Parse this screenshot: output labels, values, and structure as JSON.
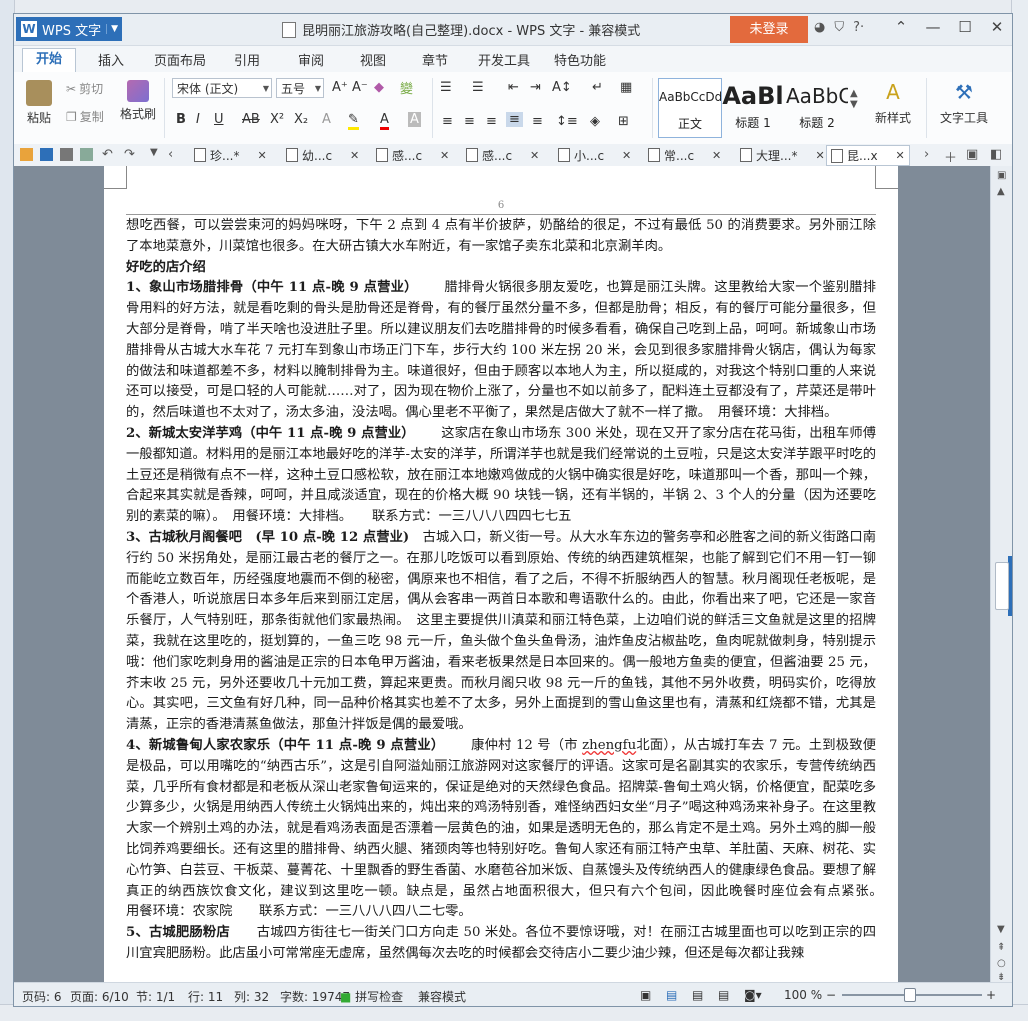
{
  "app": {
    "name": "WPS 文字",
    "window_title": "昆明丽江旅游攻略(自己整理).docx - WPS 文字 - 兼容模式",
    "login_label": "未登录"
  },
  "ribbon_tabs": [
    "开始",
    "插入",
    "页面布局",
    "引用",
    "审阅",
    "视图",
    "章节",
    "开发工具",
    "特色功能"
  ],
  "ribbon": {
    "paste": "粘贴",
    "cut": "剪切",
    "copy": "复制",
    "format_painter": "格式刷",
    "font_name": "宋体 (正文)",
    "font_size": "五号",
    "styles": [
      {
        "sample": "AaBbCcDd",
        "name": "正文"
      },
      {
        "sample": "AaBl",
        "name": "标题 1"
      },
      {
        "sample": "AaBbC",
        "name": "标题 2"
      }
    ],
    "new_style": "新样式",
    "text_tools": "文字工具"
  },
  "doc_tabs": [
    {
      "label": "珍...*"
    },
    {
      "label": "幼...c"
    },
    {
      "label": "感...c"
    },
    {
      "label": "感...c"
    },
    {
      "label": "小...c"
    },
    {
      "label": "常...c"
    },
    {
      "label": "大理...*"
    },
    {
      "label": "昆...x"
    }
  ],
  "page": {
    "number": "6"
  },
  "content": {
    "p1": "想吃西餐，可以尝尝束河的妈妈咪呀，下午 2 点到 4 点有半价披萨，奶酪给的很足，不过有最低 50 的消费要求。另外丽江除了本地菜意外，川菜馆也很多。在大研古镇大水车附近，有一家馆子卖东北菜和北京涮羊肉。",
    "h_shops": "好吃的店介绍",
    "s1_title": "1、象山市场腊排骨（中午 11 点-晚 9 点营业）",
    "s1_body": "腊排骨火锅很多朋友爱吃，也算是丽江头牌。这里教给大家一个鉴别腊排骨用料的好方法，就是看吃剩的骨头是肋骨还是脊骨，有的餐厅虽然分量不多，但都是肋骨；相反，有的餐厅可能分量很多，但大部分是脊骨，啃了半天啥也没进肚子里。所以建议朋友们去吃腊排骨的时候多看看，确保自己吃到上品，呵呵。新城象山市场腊排骨从古城大水车花 7 元打车到象山市场正门下车，步行大约 100 米左拐 20 米，会见到很多家腊排骨火锅店，偶认为每家的做法和味道都差不多，材料以腌制排骨为主。味道很好，但由于顾客以本地人为主，所以挺咸的，对我这个特别口重的人来说还可以接受，可是口轻的人可能就……对了，因为现在物价上涨了，分量也不如以前多了，配料连土豆都没有了，芹菜还是带叶的，然后味道也不太对了，汤太多油，没法喝。偶心里老不平衡了，果然是店做大了就不一样了撒。　用餐环境：大排档。",
    "s2_title": "2、新城太安洋芋鸡（中午 11 点-晚 9 点营业）",
    "s2_body": "这家店在象山市场东 300 米处，现在又开了家分店在花马街，出租车师傅一般都知道。材料用的是丽江本地最好吃的洋芋-太安的洋芋，所谓洋芋也就是我们经常说的土豆啦，只是这太安洋芋跟平时吃的土豆还是稍微有点不一样，这种土豆口感松软，放在丽江本地嫩鸡做成的火锅中确实很是好吃，味道那叫一个香，那叫一个辣，合起来其实就是香辣，呵呵，并且咸淡适宜，现在的价格大概 90 块钱一锅，还有半锅的，半锅 2、3 个人的分量（因为还要吃别的素菜的嘛）。　用餐环境：大排档。　　联系方式：一三八八八四四七七五",
    "s3_title": "3、古城秋月阁餐吧　(早 10 点-晚 12 点营业)",
    "s3_body": "古城入口，新义街一号。从大水车东边的警务亭和必胜客之间的新义街路口南行约 50 米拐角处，是丽江最古老的餐厅之一。在那儿吃饭可以看到原始、传统的纳西建筑框架，也能了解到它们不用一钉一铆而能屹立数百年，历经强度地震而不倒的秘密，偶原来也不相信，看了之后，不得不折服纳西人的智慧。秋月阁现任老板呢，是个香港人，听说旅居日本多年后来到丽江定居，偶从会客串一两首日本歌和粤语歌什么的。由此，你看出来了吧，它还是一家音乐餐厅，人气特别旺，那条街就他们家最热闹。　这里主要提供川滇菜和丽江特色菜，上边咱们说的鲜活三文鱼就是这里的招牌菜，我就在这里吃的，挺划算的，一鱼三吃 98 元一斤，鱼头做个鱼头鱼骨汤，油炸鱼皮沾椒盐吃，鱼肉呢就做刺身，特别提示哦：他们家吃刺身用的酱油是正宗的日本龟甲万酱油，看来老板果然是日本回来的。偶一般地方鱼卖的便宜，但酱油要 25 元，芥末收 25 元，另外还要收几十元加工费，算起来更贵。而秋月阁只收 98 元一斤的鱼钱，其他不另外收费，明码实价，吃得放心。其实吧，三文鱼有好几种，同一品种价格其实也差不了太多，另外上面提到的雪山鱼这里也有，清蒸和红烧都不错，尤其是清蒸，正宗的香港清蒸鱼做法，那鱼汁拌饭是偶的最爱哦。",
    "s4_title": "4、新城鲁甸人家农家乐（中午 11 点-晚 9 点营业）",
    "s4_addr": "康仲村 12 号（市 ",
    "s4_addr_word": "zhengfu",
    "s4_body": "北面），从古城打车去 7 元。土到极致便是极品，可以用嘴吃的“纳西古乐”，这是引自阿溢灿丽江旅游网对这家餐厅的评语。这家可是名副其实的农家乐，专营传统纳西菜，几乎所有食材都是和老板从深山老家鲁甸运来的，保证是绝对的天然绿色食品。招牌菜-鲁甸土鸡火锅，价格便宜，配菜吃多少算多少，火锅是用纳西人传统土火锅炖出来的，炖出来的鸡汤特别香，难怪纳西妇女坐“月子”喝这种鸡汤来补身子。在这里教大家一个辨别土鸡的办法，就是看鸡汤表面是否漂着一层黄色的油，如果是透明无色的，那么肯定不是土鸡。另外土鸡的脚一般比饲养鸡要细长。还有这里的腊排骨、纳西火腿、猪颈肉等也特别好吃。鲁甸人家还有丽江特产虫草、羊肚菌、天麻、树花、实心竹笋、白芸豆、干板菜、蔓菁花、十里飘香的野生香菌、水磨苞谷加米饭、自蒸馒头及传统纳西人的健康绿色食品。要想了解真正的纳西族饮食文化，建议到这里吃一顿。缺点是，虽然占地面积很大，但只有六个包间，因此晚餐时座位会有点紧张。　　用餐环境：农家院　　联系方式：一三八八八四八二七零。",
    "s5_title": "5、古城肥肠粉店",
    "s5_body": "古城四方街往七一街关门口方向走 50 米处。各位不要惊讶哦，对！在丽江古城里面也可以吃到正宗的四川宜宾肥肠粉。此店虽小可常常座无虚席，虽然偶每次去吃的时候都会交待店小二要少油少辣，但还是每次都让我辣"
  },
  "status": {
    "page_code": "页码: 6",
    "pages": "页面: 6/10",
    "section": "节: 1/1",
    "row": "行: 11",
    "col": "列: 32",
    "words": "字数: 19747",
    "spell": "拼写检查",
    "compat": "兼容模式",
    "zoom": "100 %"
  },
  "colors": {
    "accent": "#2d6fb8",
    "login": "#e36a3d"
  }
}
